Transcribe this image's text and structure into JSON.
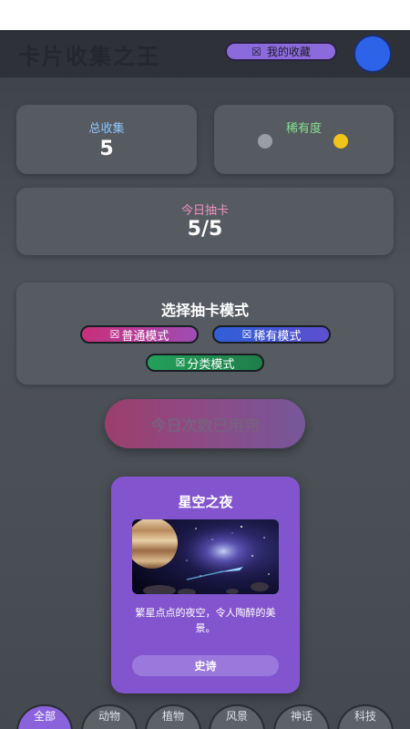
{
  "header": {
    "title": "卡片收集之王",
    "favorites_label": "我的收藏",
    "favorites_icon": "☒"
  },
  "stats": {
    "total_label": "总收集",
    "total_value": "5",
    "rarity_label": "稀有度",
    "rarity_colors": [
      "#9a9ea4",
      "#f0c419"
    ],
    "today_label": "今日抽卡",
    "today_value": "5/5"
  },
  "modes": {
    "title": "选择抽卡模式",
    "icon": "☒",
    "normal": "普通模式",
    "rare": "稀有模式",
    "category": "分类模式"
  },
  "draw_button": "今日次数已用完",
  "showcase": {
    "title": "星空之夜",
    "description": "繁星点点的夜空，令人陶醉的美景。",
    "rarity": "史诗"
  },
  "tabs": [
    "全部",
    "动物",
    "植物",
    "风景",
    "神话",
    "科技"
  ],
  "colors": {
    "accent": "#8a63dc",
    "normal_mode": "#c7307a",
    "rare_mode": "#2f5fd6",
    "category_mode": "#23a05a"
  }
}
